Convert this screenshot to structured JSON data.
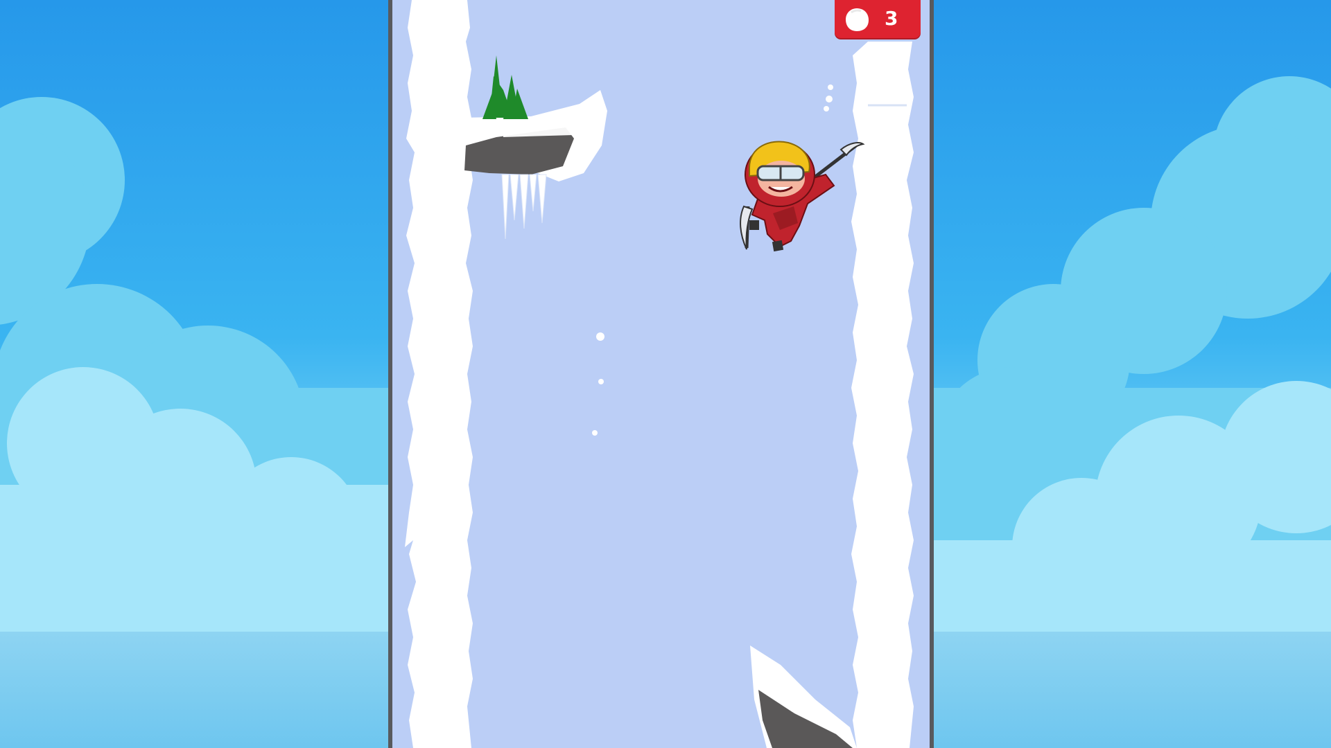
{
  "game": {
    "hud": {
      "score": "3",
      "score_icon": "snowball-icon",
      "panel_color": "#de2330"
    },
    "character": {
      "name_icon": "ice-climber",
      "state": "climbing"
    },
    "colors": {
      "sky": "#27a2ec",
      "cloud": "#8fdcf5",
      "well_background": "#b5c9f5",
      "ice_wall": "#ffffff",
      "frame": "#585a5e",
      "rock": "#5a5858",
      "tree": "#1f8a2a"
    }
  }
}
